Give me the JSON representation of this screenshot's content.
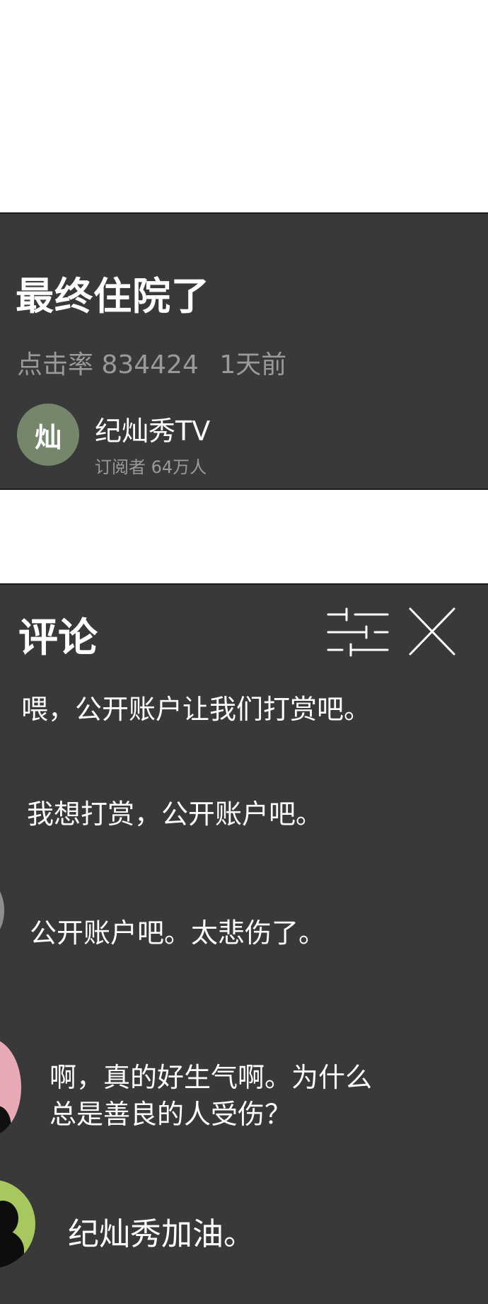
{
  "video": {
    "title": "最终住院了",
    "views_label": "点击率 834424",
    "time_ago": "1天前",
    "channel": {
      "avatar_text": "灿",
      "name": "纪灿秀TV",
      "subscribers": "订阅者 64万人"
    }
  },
  "comments_section": {
    "title": "评论",
    "icons": {
      "filter": "sliders-icon",
      "close": "close-icon"
    },
    "items": [
      {
        "text": "喂，公开账户让我们打赏吧。"
      },
      {
        "text": "我想打赏，公开账户吧。"
      },
      {
        "text": "公开账户吧。太悲伤了。"
      },
      {
        "line1": "啊，真的好生气啊。为什么",
        "line2": "总是善良的人受伤？"
      },
      {
        "text": "纪灿秀加油。"
      }
    ]
  },
  "colors": {
    "panel_bg": "#393939",
    "text_primary": "#ffffff",
    "text_secondary": "#9a9a9a",
    "channel_avatar": "#76866a",
    "avatar_gray": "#8e8e8e",
    "avatar_pink": "#e8aab6",
    "avatar_green": "#a7c85e"
  }
}
